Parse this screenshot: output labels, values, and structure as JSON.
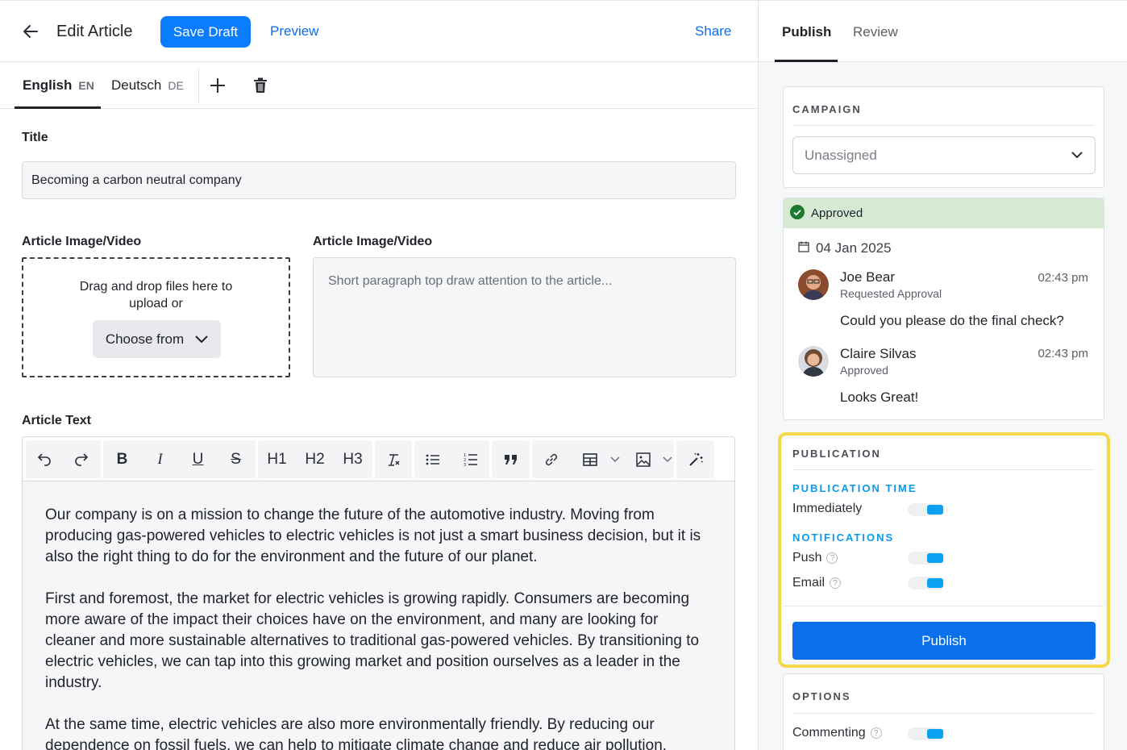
{
  "header": {
    "title": "Edit Article",
    "save_draft": "Save Draft",
    "preview": "Preview",
    "share": "Share"
  },
  "languages": [
    {
      "label": "English",
      "code": "EN",
      "active": true
    },
    {
      "label": "Deutsch",
      "code": "DE",
      "active": false
    }
  ],
  "form": {
    "title_label": "Title",
    "title_value": "Becoming a carbon neutral company",
    "image_label": "Article Image/Video",
    "dropzone_text": "Drag and drop files here to upload or",
    "choose_from": "Choose from",
    "summary_label": "Article Image/Video",
    "summary_placeholder": "Short paragraph top draw attention to the article...",
    "text_label": "Article Text"
  },
  "toolbar": {
    "h1": "H1",
    "h2": "H2",
    "h3": "H3"
  },
  "article": {
    "paragraphs": [
      "Our company is on a mission to change the future of the automotive industry. Moving from producing gas-powered vehicles to electric vehicles is not just a smart business decision, but it is also the right thing to do for the environment and the future of our planet.",
      "First and foremost, the market for electric vehicles is growing rapidly. Consumers are becoming more aware of the impact their choices have on the environment, and many are looking for cleaner and more sustainable alternatives to traditional gas-powered vehicles. By transitioning to electric vehicles, we can tap into this growing market and position ourselves as a leader in the industry.",
      "At the same time, electric vehicles are also more environmentally friendly. By reducing our dependence on fossil fuels, we can help to mitigate climate change and reduce air pollution."
    ]
  },
  "sidebar": {
    "tabs": [
      "Publish",
      "Review"
    ],
    "campaign": {
      "title": "CAMPAIGN",
      "selected": "Unassigned"
    },
    "approval": {
      "status": "Approved",
      "date": "04 Jan 2025",
      "comments": [
        {
          "name": "Joe Bear",
          "action": "Requested Approval",
          "time": "02:43 pm",
          "message": "Could you please do the final check?"
        },
        {
          "name": "Claire Silvas",
          "action": "Approved",
          "time": "02:43 pm",
          "message": "Looks Great!"
        }
      ]
    },
    "publication": {
      "title": "PUBLICATION",
      "time_title": "PUBLICATION TIME",
      "immediately": "Immediately",
      "notifications_title": "NOTIFICATIONS",
      "push": "Push",
      "email": "Email",
      "publish_button": "Publish"
    },
    "options": {
      "title": "OPTIONS",
      "commenting": "Commenting"
    }
  },
  "colors": {
    "primary": "#0a7cff",
    "highlight": "#f3d94a",
    "approved_bg": "#d5e9d3",
    "toggle_on": "#0aa1f0"
  }
}
